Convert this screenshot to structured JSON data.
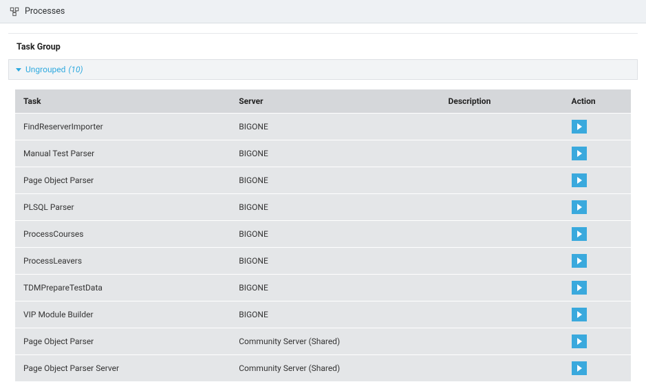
{
  "header": {
    "title": "Processes"
  },
  "section": {
    "title": "Task Group"
  },
  "group": {
    "label": "Ungrouped",
    "count": "(10)"
  },
  "columns": {
    "task": "Task",
    "server": "Server",
    "description": "Description",
    "action": "Action"
  },
  "rows": [
    {
      "task": "FindReserverImporter",
      "server": "BIGONE",
      "description": ""
    },
    {
      "task": "Manual Test Parser",
      "server": "BIGONE",
      "description": ""
    },
    {
      "task": "Page Object Parser",
      "server": "BIGONE",
      "description": ""
    },
    {
      "task": "PLSQL Parser",
      "server": "BIGONE",
      "description": ""
    },
    {
      "task": "ProcessCourses",
      "server": "BIGONE",
      "description": ""
    },
    {
      "task": "ProcessLeavers",
      "server": "BIGONE",
      "description": ""
    },
    {
      "task": "TDMPrepareTestData",
      "server": "BIGONE",
      "description": ""
    },
    {
      "task": "VIP Module Builder",
      "server": "BIGONE",
      "description": ""
    },
    {
      "task": "Page Object Parser",
      "server": "Community Server (Shared)",
      "description": ""
    },
    {
      "task": "Page Object Parser Server",
      "server": "Community Server (Shared)",
      "description": ""
    }
  ]
}
